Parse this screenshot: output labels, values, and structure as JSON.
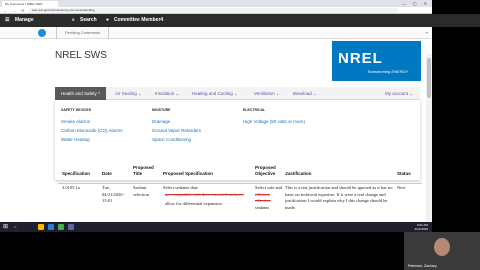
{
  "browser": {
    "tab_title": "My Comments | NREL SWS",
    "url": "sws.nrel.gov/comments/my-comments/pending"
  },
  "appbar": {
    "manage": "Manage",
    "search": "Search",
    "user": "Committee Member4"
  },
  "subbar": {
    "pending_tab": "Pending Comments"
  },
  "page_title": "NREL SWS",
  "logo": {
    "mark": "NREL",
    "tagline": "Transforming ENERGY"
  },
  "nav": {
    "items": [
      "Health and Safety ^",
      "Air Sealing ⌄",
      "Insulation ⌄",
      "Heating and Cooling ⌄",
      "Ventilation ⌄",
      "Baseload ⌄"
    ],
    "account": "My account ⌄"
  },
  "mega": {
    "col1": {
      "header": "SAFETY DEVICES",
      "links": [
        "Smoke Alarms",
        "Carbon Monoxide (CO) Alarms",
        "Water Heating"
      ]
    },
    "col2": {
      "header": "MOISTURE",
      "links": [
        "Drainage",
        "Ground Vapor Retarders",
        "Space Conditioning"
      ]
    },
    "col3": {
      "header": "ELECTRICAL",
      "links": [
        "High Voltage (50 volts or more)"
      ]
    }
  },
  "table": {
    "headers": {
      "spec": "Specification",
      "date": "Date",
      "title": "Proposed Title",
      "proposed_spec": "Proposed Specification",
      "objective": "Proposed Objective",
      "justification": "Justification",
      "status": "Status"
    },
    "row": {
      "spec": "3.0105.1a",
      "date": "Tue, 04/21/2020 - 15:01",
      "title": "Sealant selection",
      "proposed_spec_a": "Select sealants that:",
      "proposed_spec_strike": "are compatible with their intended surfaces,",
      "proposed_spec_b": "allow for differential expansion",
      "objective_a": "Select safe and",
      "objective_strike": "efficient effective",
      "objective_b": "sealants",
      "justification": "This is a test justification and should be ignored as it has no basis on technical expertise. If it were a real change and justification I would explain why I this change should be made.",
      "status": "New"
    }
  },
  "taskbar": {
    "time": "9:01 AM",
    "date": "4/21/2020"
  },
  "video": {
    "name": "Peterson, Zachary"
  }
}
